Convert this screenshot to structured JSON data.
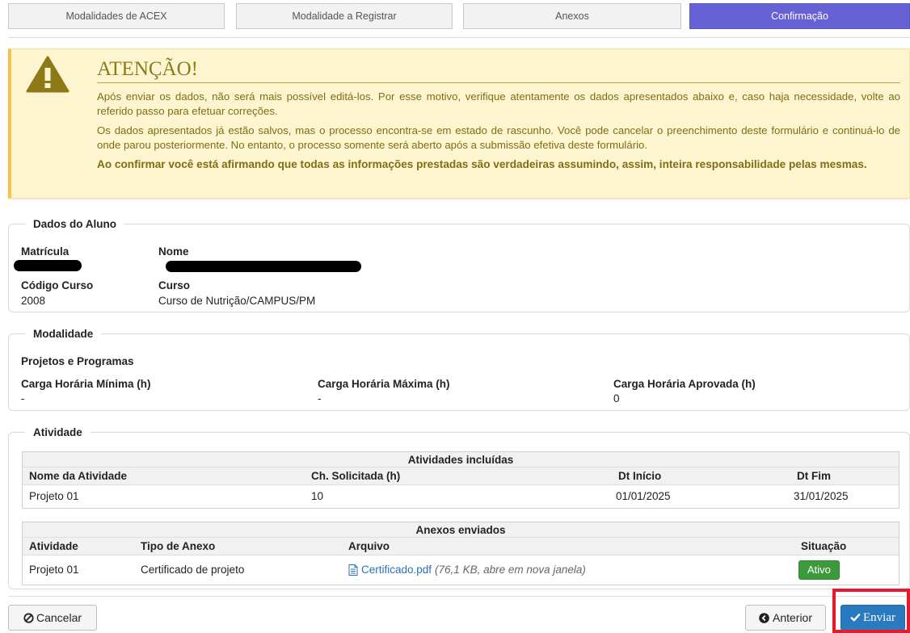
{
  "steps": [
    "Modalidades de ACEX",
    "Modalidade a Registrar",
    "Anexos",
    "Confirmação"
  ],
  "warning": {
    "title": "ATENÇÃO!",
    "p1": "Após enviar os dados, não será mais possível editá-los. Por esse motivo, verifique atentamente os dados apresentados abaixo e, caso haja necessidade, volte ao referido passo para efetuar correções.",
    "p2": "Os dados apresentados já estão salvos, mas o processo encontra-se em estado de rascunho. Você pode cancelar o preenchimento deste formulário e continuá-lo de onde parou posteriormente. No entanto, o processo somente será aberto após a submissão efetiva deste formulário.",
    "p3": "Ao confirmar você está afirmando que todas as informações prestadas são verdadeiras assumindo, assim, inteira responsabilidade pelas mesmas."
  },
  "aluno": {
    "legend": "Dados do Aluno",
    "matricula_label": "Matrícula",
    "nome_label": "Nome",
    "codigo_label": "Código Curso",
    "codigo_value": "2008",
    "curso_label": "Curso",
    "curso_value": "Curso de Nutrição/CAMPUS/PM"
  },
  "modalidade": {
    "legend": "Modalidade",
    "name": "Projetos e Programas",
    "min_label": "Carga Horária Mínima (h)",
    "min_value": "-",
    "max_label": "Carga Horária Máxima (h)",
    "max_value": "-",
    "aprov_label": "Carga Horária Aprovada (h)",
    "aprov_value": "0"
  },
  "atividade": {
    "legend": "Atividade",
    "atividades": {
      "caption": "Atividades incluídas",
      "headers": [
        "Nome da Atividade",
        "Ch. Solicitada (h)",
        "Dt Início",
        "Dt Fim"
      ],
      "rows": [
        {
          "nome": "Projeto 01",
          "ch": "10",
          "inicio": "01/01/2025",
          "fim": "31/01/2025"
        }
      ]
    },
    "anexos": {
      "caption": "Anexos enviados",
      "headers": [
        "Atividade",
        "Tipo de Anexo",
        "Arquivo",
        "Situação"
      ],
      "rows": [
        {
          "atividade": "Projeto 01",
          "tipo": "Certificado de projeto",
          "arquivo": "Certificado.pdf",
          "info": "(76,1 KB, abre em nova janela)",
          "situacao": "Ativo"
        }
      ]
    }
  },
  "buttons": {
    "cancelar": "Cancelar",
    "anterior": "Anterior",
    "enviar": "Enviar"
  },
  "colors": {
    "active_step": "#6761d6",
    "primary": "#2a7ac0",
    "warning_bg": "#fcf5d0",
    "success": "#3c9a3c",
    "highlight": "#e8192c"
  }
}
